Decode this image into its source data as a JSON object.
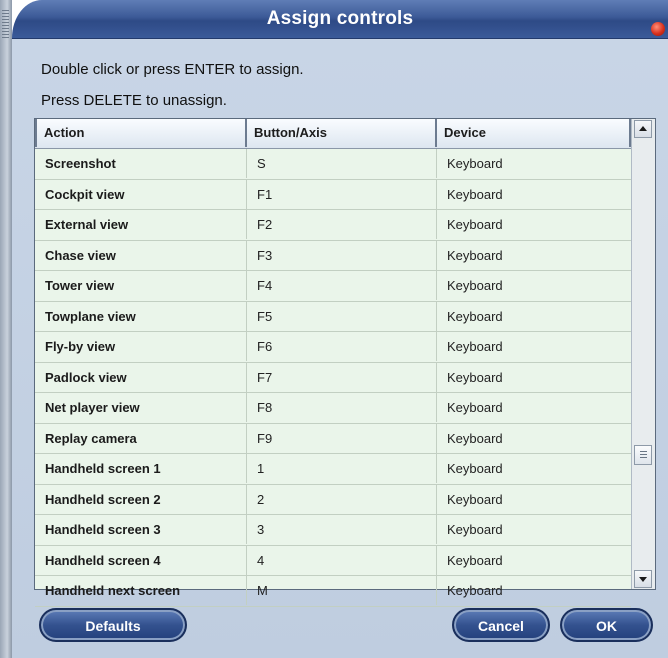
{
  "window": {
    "title": "Assign controls"
  },
  "instructions": {
    "line1": "Double click or press ENTER to assign.",
    "line2": "Press DELETE to unassign."
  },
  "table": {
    "columns": [
      "Action",
      "Button/Axis",
      "Device"
    ],
    "rows": [
      {
        "action": "Screenshot",
        "key": "S",
        "device": "Keyboard"
      },
      {
        "action": "Cockpit view",
        "key": "F1",
        "device": "Keyboard"
      },
      {
        "action": "External view",
        "key": "F2",
        "device": "Keyboard"
      },
      {
        "action": "Chase view",
        "key": "F3",
        "device": "Keyboard"
      },
      {
        "action": "Tower view",
        "key": "F4",
        "device": "Keyboard"
      },
      {
        "action": "Towplane view",
        "key": "F5",
        "device": "Keyboard"
      },
      {
        "action": "Fly-by view",
        "key": "F6",
        "device": "Keyboard"
      },
      {
        "action": "Padlock view",
        "key": "F7",
        "device": "Keyboard"
      },
      {
        "action": "Net player view",
        "key": "F8",
        "device": "Keyboard"
      },
      {
        "action": "Replay camera",
        "key": "F9",
        "device": "Keyboard"
      },
      {
        "action": "Handheld screen 1",
        "key": "1",
        "device": "Keyboard"
      },
      {
        "action": "Handheld screen 2",
        "key": "2",
        "device": "Keyboard"
      },
      {
        "action": "Handheld screen 3",
        "key": "3",
        "device": "Keyboard"
      },
      {
        "action": "Handheld screen 4",
        "key": "4",
        "device": "Keyboard"
      },
      {
        "action": "Handheld next screen",
        "key": "M",
        "device": "Keyboard"
      }
    ]
  },
  "buttons": {
    "defaults": "Defaults",
    "cancel": "Cancel",
    "ok": "OK"
  },
  "colors": {
    "titlebar": "#3c5a97",
    "panel": "#c8d5e6",
    "table_bg": "#eaf5ea",
    "close": "#d8301c"
  },
  "icons": [
    "close-icon",
    "scroll-up-icon",
    "scroll-down-icon",
    "scroll-thumb-grip-icon"
  ]
}
